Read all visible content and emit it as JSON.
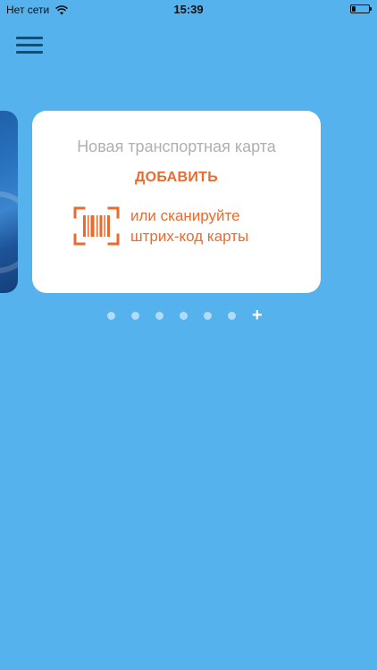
{
  "status_bar": {
    "carrier": "Нет сети",
    "time": "15:39",
    "battery_level": 0.2
  },
  "menu": {
    "icon": "hamburger-menu-icon"
  },
  "add_card": {
    "title": "Новая транспортная карта",
    "add_label": "ДОБАВИТЬ",
    "scan_line1": "или сканируйте",
    "scan_line2": "штрих-код карты",
    "scan_icon": "barcode-scan-icon"
  },
  "pager": {
    "dot_count": 6,
    "add_label": "+"
  },
  "colors": {
    "background": "#55b2ec",
    "accent": "#e96b2e",
    "muted_text": "#b0b0b0",
    "menu_icon": "#1f4a6b"
  }
}
